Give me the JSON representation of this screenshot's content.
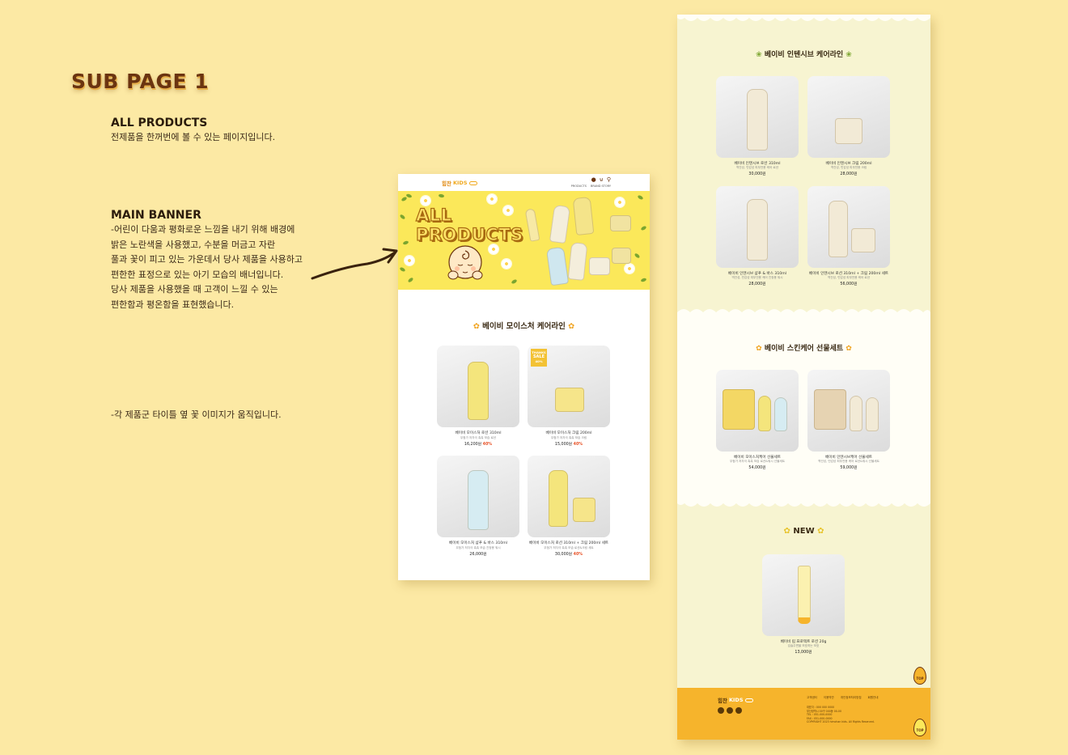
{
  "page_title": "SUB PAGE 1",
  "notes": {
    "all_products": {
      "heading": "ALL PRODUCTS",
      "body": "전제품을 한꺼번에 볼 수 있는 페이지입니다."
    },
    "main_banner": {
      "heading": "MAIN BANNER",
      "lines": [
        "-어린이 다움과 평화로운 느낌을 내기 위해 배경에",
        "밝은 노란색을 사용했고,  수분을 머금고 자란",
        "풀과 꽃이 피고 있는 가운데서  당사 제품을 사용하고",
        "편한한 표정으로 있는 아기 모습의 배너입니다.",
        "당사 제품을 사용했을 때 고객이 느낄 수 있는",
        "편한함과 평온함을 표현했습니다."
      ]
    },
    "motion_note": "-각 제품군 타이틀 옆 꽃 이미지가 움직입니다."
  },
  "site": {
    "logo_brand": "힘찬",
    "logo_kids": "KIDS",
    "menu": [
      "PRODUCTS",
      "BRAND STORY"
    ],
    "banner_title_line1": "ALL",
    "banner_title_line2": "PRODUCTS",
    "footer_links": [
      "고객센터",
      "이용약관",
      "개인정보처리방침",
      "회원안내"
    ],
    "footer_info": [
      "대표자 : 000 000 0000",
      "부산광역시 00구 000동 00-00",
      "TEL : 051-000-0000",
      "FAX : 051-000-0000",
      "COPYRIGHT 2023 himchan kids. All Rights Reserved."
    ],
    "top_label": "TOP"
  },
  "colors": {
    "background": "#fce9a4",
    "accent": "#f6b42c",
    "banner": "#fbe85a",
    "sale": "#e8542a"
  },
  "sections": {
    "moisture": {
      "title": "베이비 모이스처 케어라인",
      "products": [
        {
          "name": "베이비 모이스처 로션 310ml",
          "sub": "무첨가 저자극 촉촉 보습 로션",
          "old": "",
          "price": "16,200원",
          "discount": "40%"
        },
        {
          "name": "베이비 모이스처 크림 200ml",
          "sub": "무첨가 저자극 촉촉 보습 크림",
          "old": "",
          "price": "15,000원",
          "discount": "40%"
        },
        {
          "name": "베이비 모이스처 샴푸 & 바스 310ml",
          "sub": "무첨가 저자극 촉촉 보습 진정용 워시",
          "old": "",
          "price": "26,000원",
          "discount": ""
        },
        {
          "name": "베이비 모이스처 로션 310ml + 크림 200ml 세트",
          "sub": "무첨가 저자극 촉촉 보습 로션&크림 세트",
          "old": "",
          "price": "30,000원",
          "discount": "40%"
        }
      ],
      "sale_badge": [
        "THANKS",
        "SALE",
        "40%"
      ]
    },
    "intensive": {
      "title": "베이비 인텐시브 케어라인",
      "products": [
        {
          "name": "베이비 인텐시브 로션 310ml",
          "sub": "역건성, 민감성 피부전용 케어 로션",
          "price": "30,000원"
        },
        {
          "name": "베이비 인텐시브 크림 200ml",
          "sub": "역건성, 민감성 피부전용 크림",
          "price": "28,000원"
        },
        {
          "name": "베이비 인텐시브 샴푸 & 바스 310ml",
          "sub": "역건성, 민감성 피부전용 케어 진정용 워시",
          "price": "28,000원"
        },
        {
          "name": "베이비 인텐시브 로션 310ml + 크림 200ml 세트",
          "sub": "역건성, 민감성 피부전용 케어 로션",
          "price": "56,000원"
        }
      ]
    },
    "gift": {
      "title": "베이비 스킨케어 선물세트",
      "products": [
        {
          "name": "베이비 모이스처케어 선물세트",
          "sub": "무첨가 저자극 촉촉 보습 로션&워시 선물세트",
          "price": "54,000원"
        },
        {
          "name": "베이비 인텐시브케어 선물세트",
          "sub": "역건성, 민감성 피부전용 케어 로션&워시 선물세트",
          "price": "59,000원"
        }
      ]
    },
    "new": {
      "title": "NEW",
      "products": [
        {
          "name": "베이비 립 프로텍트 로션 20g",
          "sub": "입술주변을 보호하는 보호",
          "price": "13,000원"
        }
      ]
    }
  }
}
